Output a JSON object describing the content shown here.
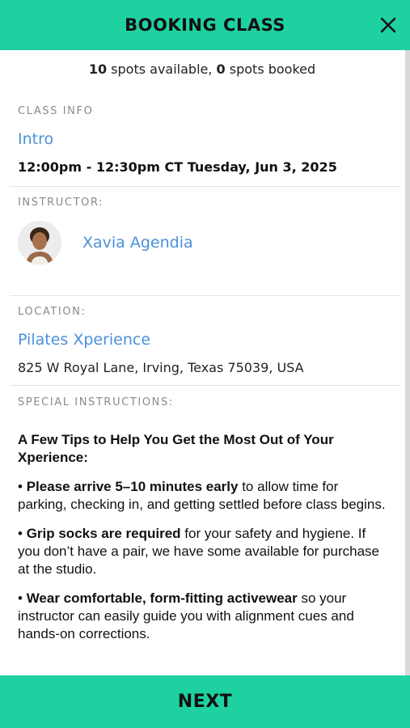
{
  "header": {
    "title": "BOOKING CLASS"
  },
  "availability": {
    "spots_available_count": "10",
    "spots_available_text": " spots available, ",
    "spots_booked_count": "0",
    "spots_booked_text": " spots booked"
  },
  "class_info": {
    "label": "CLASS INFO",
    "class_name": "Intro",
    "time": "12:00pm - 12:30pm CT Tuesday, Jun 3, 2025"
  },
  "instructor": {
    "label": "INSTRUCTOR:",
    "name": "Xavia Agendia"
  },
  "location": {
    "label": "LOCATION:",
    "name": "Pilates Xperience",
    "address": "825 W Royal Lane, Irving, Texas 75039, USA"
  },
  "special_instructions": {
    "label": "SPECIAL INSTRUCTIONS:",
    "heading": "A Few Tips to Help You Get the Most Out of Your Xperience:",
    "tips": [
      {
        "bullet": "• ",
        "bold": "Please arrive 5–10 minutes early",
        "rest": " to allow time for parking, checking in, and getting settled before class begins."
      },
      {
        "bullet": "• ",
        "bold": "Grip socks are required",
        "rest": " for your safety and hygiene. If you don’t have a pair, we have some available for purchase at the studio."
      },
      {
        "bullet": "• ",
        "bold": "Wear comfortable, form-fitting activewear",
        "rest": " so your instructor can easily guide you with alignment cues and hands-on corrections."
      }
    ]
  },
  "footer": {
    "next_label": "NEXT"
  },
  "colors": {
    "accent": "#1fd1a0",
    "link": "#4a90d9"
  },
  "icons": {
    "close": "close-icon"
  }
}
